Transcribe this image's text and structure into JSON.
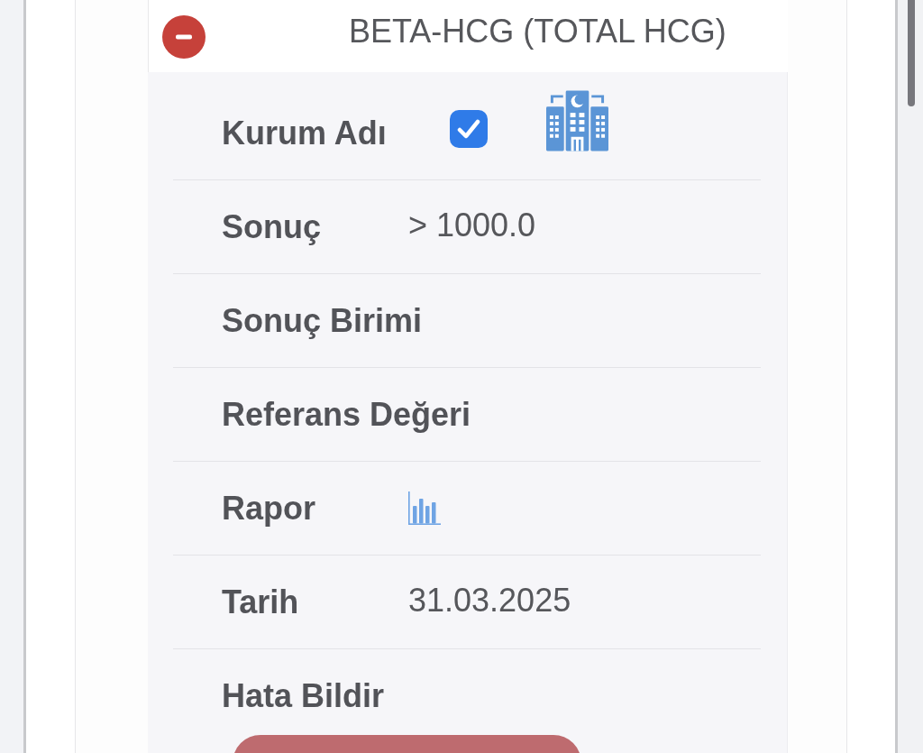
{
  "card": {
    "title": "BETA-HCG (TOTAL HCG)",
    "expanded": true,
    "rows": [
      {
        "kind": "institution",
        "label": "Kurum Adı",
        "checked": true
      },
      {
        "kind": "text",
        "label": "Sonuç",
        "value": "> 1000.0"
      },
      {
        "kind": "text",
        "label": "Sonuç Birimi"
      },
      {
        "kind": "text",
        "label": "Referans Değeri"
      },
      {
        "kind": "report",
        "label": "Rapor"
      },
      {
        "kind": "text",
        "label": "Tarih",
        "value": "31.03.2025"
      },
      {
        "kind": "error_report",
        "label": "Hata Bildir"
      }
    ]
  }
}
